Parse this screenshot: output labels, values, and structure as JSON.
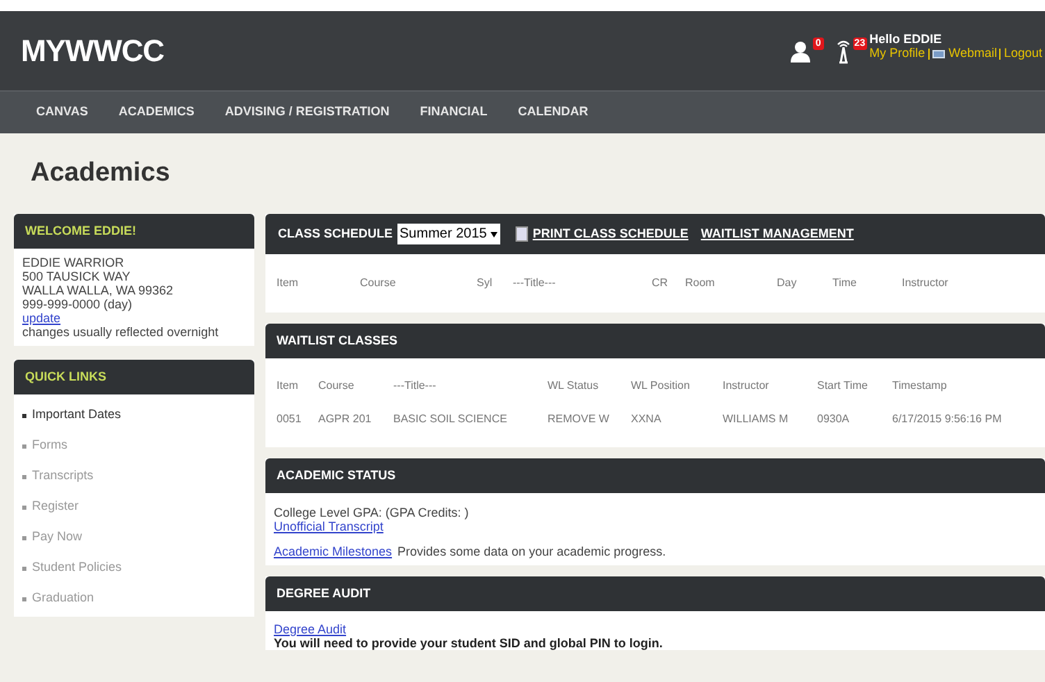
{
  "header": {
    "logo": "MYWWCC",
    "profile_badge": "0",
    "alerts_badge": "23",
    "greeting": "Hello EDDIE",
    "links": [
      {
        "label": "My Profile"
      },
      {
        "label": "Webmail",
        "kind": "mail"
      },
      {
        "label": "Logout"
      }
    ]
  },
  "nav": [
    {
      "label": "CANVAS"
    },
    {
      "label": "ACADEMICS"
    },
    {
      "label": "ADVISING / REGISTRATION"
    },
    {
      "label": "FINANCIAL"
    },
    {
      "label": "CALENDAR"
    }
  ],
  "page_title": "Academics",
  "welcome": {
    "title": "WELCOME EDDIE!",
    "lines": [
      "EDDIE WARRIOR",
      "500 TAUSICK WAY",
      "WALLA WALLA, WA 99362",
      "999-999-0000 (day)"
    ],
    "link": "update",
    "note": "changes usually reflected overnight"
  },
  "quick_links": {
    "title": "QUICK LINKS",
    "items": [
      {
        "label": "Important Dates",
        "selected": true
      },
      {
        "label": "Forms",
        "selected": false
      },
      {
        "label": "Transcripts",
        "selected": false
      },
      {
        "label": "Register",
        "selected": false
      },
      {
        "label": "Pay Now",
        "selected": false
      },
      {
        "label": "Student Policies",
        "selected": false
      },
      {
        "label": "Graduation",
        "selected": false
      }
    ]
  },
  "class_schedule": {
    "title": "CLASS SCHEDULE",
    "term": "Summer 2015",
    "print_link": "PRINT CLASS SCHEDULE",
    "waitlist_link": "WAITLIST MANAGEMENT",
    "columns": [
      "Item",
      "Course",
      "Syl",
      "---Title---",
      "CR",
      "Room",
      "Day",
      "Time",
      "Instructor"
    ]
  },
  "waitlist": {
    "title": "WAITLIST CLASSES",
    "columns": [
      "Item",
      "Course",
      "---Title---",
      "WL Status",
      "WL Position",
      "Instructor",
      "Start Time",
      "Timestamp"
    ],
    "rows": [
      [
        "0051",
        "AGPR 201",
        "BASIC SOIL SCIENCE",
        "REMOVE W",
        "XXNA",
        "WILLIAMS M",
        "0930A",
        "6/17/2015 9:56:16 PM"
      ]
    ]
  },
  "academic_status": {
    "title": "ACADEMIC STATUS",
    "gpa_line": "College Level GPA: (GPA Credits: )",
    "transcript_link": "Unofficial Transcript",
    "milestones_link": "Academic Milestones",
    "milestones_text": "Provides some data on your academic progress."
  },
  "degree_audit": {
    "title": "DEGREE AUDIT",
    "link": "Degree Audit",
    "note": "You will need to provide your student SID and global PIN to login."
  }
}
